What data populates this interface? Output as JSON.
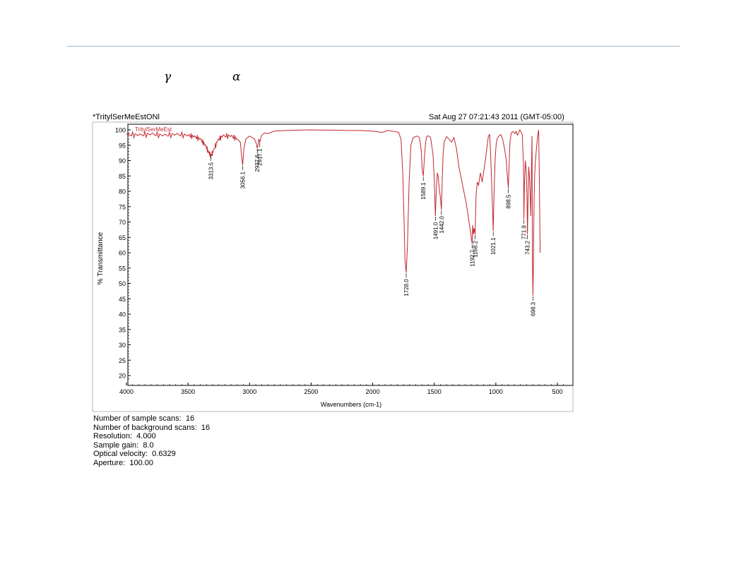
{
  "header": {
    "symbol_1": "γ",
    "symbol_2": "α",
    "sample_name": "*TritylSerMeEstONl",
    "timestamp": "Sat Aug 27 07:21:43 2011 (GMT-05:00)"
  },
  "chart_data": {
    "type": "line",
    "title": "",
    "xlabel": "Wavenumbers (cm-1)",
    "ylabel": "% Transmittance",
    "xlim": [
      4000,
      400
    ],
    "ylim": [
      17,
      101
    ],
    "x_reversed": true,
    "x_ticks": [
      4000,
      3500,
      3000,
      2500,
      2000,
      1500,
      1000,
      500
    ],
    "y_ticks": [
      100,
      95,
      90,
      85,
      80,
      75,
      70,
      65,
      60,
      55,
      50,
      45,
      40,
      35,
      30,
      25,
      20
    ],
    "grid": false,
    "legend": "none",
    "color": "#c0272d",
    "series": [
      {
        "name": "TritylSerMeEst",
        "points": [
          [
            4000,
            98.5
          ],
          [
            3900,
            98.3
          ],
          [
            3800,
            98.6
          ],
          [
            3700,
            98.2
          ],
          [
            3600,
            98.5
          ],
          [
            3500,
            98.2
          ],
          [
            3450,
            97.8
          ],
          [
            3400,
            97
          ],
          [
            3360,
            95
          ],
          [
            3330,
            92.5
          ],
          [
            3313.5,
            91.5
          ],
          [
            3295,
            93
          ],
          [
            3260,
            96.5
          ],
          [
            3220,
            98
          ],
          [
            3150,
            98
          ],
          [
            3100,
            97
          ],
          [
            3075,
            96
          ],
          [
            3066,
            92
          ],
          [
            3056.1,
            88.5
          ],
          [
            3046,
            94
          ],
          [
            3030,
            97
          ],
          [
            3000,
            98
          ],
          [
            2960,
            97
          ],
          [
            2945,
            95.5
          ],
          [
            2937.6,
            94
          ],
          [
            2930,
            95.5
          ],
          [
            2925,
            97
          ],
          [
            2917.1,
            96
          ],
          [
            2905,
            98
          ],
          [
            2880,
            99
          ],
          [
            2850,
            98.8
          ],
          [
            2800,
            99.6
          ],
          [
            2700,
            99.8
          ],
          [
            2600,
            99.9
          ],
          [
            2500,
            100
          ],
          [
            2400,
            99.9
          ],
          [
            2300,
            99.9
          ],
          [
            2200,
            99.8
          ],
          [
            2100,
            99.8
          ],
          [
            2000,
            99.6
          ],
          [
            1950,
            99.3
          ],
          [
            1920,
            99.2
          ],
          [
            1880,
            99.8
          ],
          [
            1820,
            99.5
          ],
          [
            1790,
            99.2
          ],
          [
            1770,
            97
          ],
          [
            1755,
            85
          ],
          [
            1745,
            70
          ],
          [
            1738,
            58
          ],
          [
            1728.0,
            53.5
          ],
          [
            1718,
            62
          ],
          [
            1705,
            82
          ],
          [
            1690,
            95
          ],
          [
            1670,
            97.5
          ],
          [
            1640,
            98
          ],
          [
            1620,
            97.5
          ],
          [
            1605,
            93
          ],
          [
            1598,
            87
          ],
          [
            1589.1,
            85
          ],
          [
            1580,
            91
          ],
          [
            1570,
            96
          ],
          [
            1560,
            98
          ],
          [
            1545,
            98
          ],
          [
            1530,
            97.5
          ],
          [
            1510,
            92
          ],
          [
            1500,
            84
          ],
          [
            1491.0,
            72
          ],
          [
            1482,
            82
          ],
          [
            1475,
            86
          ],
          [
            1468,
            85
          ],
          [
            1460,
            81
          ],
          [
            1450,
            78
          ],
          [
            1442.0,
            74
          ],
          [
            1435,
            84
          ],
          [
            1428,
            92
          ],
          [
            1420,
            96
          ],
          [
            1400,
            97.8
          ],
          [
            1380,
            97
          ],
          [
            1360,
            96
          ],
          [
            1340,
            97.5
          ],
          [
            1320,
            94
          ],
          [
            1300,
            88
          ],
          [
            1280,
            84
          ],
          [
            1260,
            80
          ],
          [
            1240,
            76
          ],
          [
            1225,
            72
          ],
          [
            1210,
            68
          ],
          [
            1200,
            65
          ],
          [
            1192.7,
            63
          ],
          [
            1188,
            69
          ],
          [
            1182,
            66
          ],
          [
            1176,
            68
          ],
          [
            1168.2,
            66
          ],
          [
            1160,
            79
          ],
          [
            1150,
            83
          ],
          [
            1140,
            82
          ],
          [
            1125,
            86
          ],
          [
            1110,
            83
          ],
          [
            1100,
            86
          ],
          [
            1085,
            90
          ],
          [
            1070,
            95
          ],
          [
            1060,
            98
          ],
          [
            1050,
            98.5
          ],
          [
            1042,
            92
          ],
          [
            1035,
            84
          ],
          [
            1028,
            76
          ],
          [
            1021.1,
            67
          ],
          [
            1014,
            80
          ],
          [
            1006,
            90
          ],
          [
            998,
            95
          ],
          [
            990,
            97
          ],
          [
            975,
            98
          ],
          [
            960,
            98.5
          ],
          [
            945,
            97
          ],
          [
            930,
            94
          ],
          [
            918,
            91
          ],
          [
            908,
            86
          ],
          [
            898.5,
            81
          ],
          [
            892,
            89
          ],
          [
            885,
            96
          ],
          [
            875,
            99
          ],
          [
            860,
            99.5
          ],
          [
            845,
            98.8
          ],
          [
            835,
            99.5
          ],
          [
            825,
            98.3
          ],
          [
            815,
            99
          ],
          [
            805,
            100
          ],
          [
            795,
            99.3
          ],
          [
            785,
            98.5
          ],
          [
            775,
            88
          ],
          [
            771.9,
            71
          ],
          [
            768,
            82
          ],
          [
            760,
            90
          ],
          [
            752,
            86
          ],
          [
            747,
            78
          ],
          [
            743.2,
            66
          ],
          [
            739,
            76
          ],
          [
            733,
            88
          ],
          [
            727,
            85
          ],
          [
            722,
            80
          ],
          [
            716,
            72
          ],
          [
            711,
            86
          ],
          [
            706,
            98
          ],
          [
            703,
            60
          ],
          [
            700,
            50
          ],
          [
            698.3,
            46
          ],
          [
            695,
            55
          ],
          [
            690,
            75
          ],
          [
            685,
            85
          ],
          [
            678,
            90
          ],
          [
            670,
            94
          ],
          [
            660,
            98
          ],
          [
            652,
            100
          ],
          [
            647,
            86
          ],
          [
            640,
            60
          ]
        ]
      }
    ],
    "peak_labels": [
      {
        "x": 3313.5,
        "label": "3313.5",
        "y": 91.5
      },
      {
        "x": 3056.1,
        "label": "3056.1",
        "y": 88.5
      },
      {
        "x": 2937.6,
        "label": "2937.6",
        "y": 94
      },
      {
        "x": 2917.1,
        "label": "2917.1",
        "y": 96
      },
      {
        "x": 1728.0,
        "label": "1728.0",
        "y": 53.5
      },
      {
        "x": 1589.1,
        "label": "1589.1",
        "y": 85
      },
      {
        "x": 1491.0,
        "label": "1491.0",
        "y": 72
      },
      {
        "x": 1442.0,
        "label": "1442.0",
        "y": 74
      },
      {
        "x": 1192.7,
        "label": "1192.7",
        "y": 63
      },
      {
        "x": 1168.2,
        "label": "1168.2",
        "y": 66
      },
      {
        "x": 1021.1,
        "label": "1021.1",
        "y": 67
      },
      {
        "x": 898.5,
        "label": "898.5",
        "y": 81
      },
      {
        "x": 771.9,
        "label": "771.9",
        "y": 71
      },
      {
        "x": 743.2,
        "label": "743.2",
        "y": 66
      },
      {
        "x": 698.3,
        "label": "698.3",
        "y": 46
      }
    ]
  },
  "instrument_info": {
    "sample_scans": "Number of sample scans:  16",
    "background_scans": "Number of background scans:  16",
    "resolution": "Resolution:  4.000",
    "sample_gain": "Sample gain:  8.0",
    "optical_velocity": "Optical velocity:  0.6329",
    "aperture": "Aperture:  100.00"
  }
}
